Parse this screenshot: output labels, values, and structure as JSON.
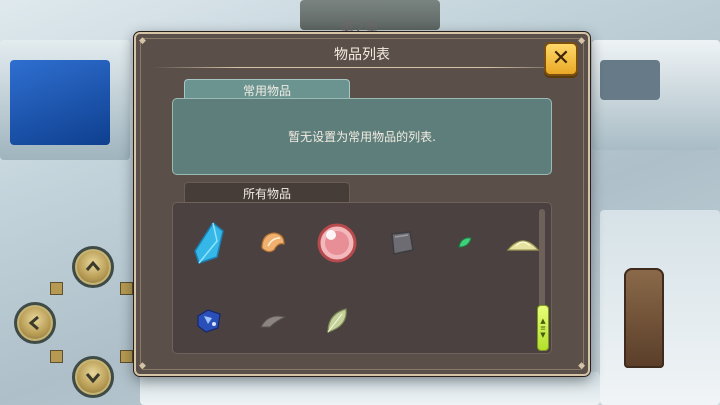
{
  "header": {
    "chapter": "第2章"
  },
  "modal": {
    "title": "物品列表",
    "close_symbol": "✕",
    "frequent_tab": "常用物品",
    "empty_message": "暂无设置为常用物品的列表.",
    "all_tab": "所有物品"
  },
  "items": [
    {
      "icon": "blue-crystal-icon"
    },
    {
      "icon": "orange-shell-icon"
    },
    {
      "icon": "pink-orb-icon"
    },
    {
      "icon": "gray-stone-icon"
    },
    {
      "icon": "green-leaf-icon"
    },
    {
      "icon": "yellow-powder-icon"
    },
    {
      "icon": "blue-ore-icon"
    },
    {
      "icon": "gray-feather-icon"
    },
    {
      "icon": "pale-green-leaf-icon"
    }
  ],
  "colors": {
    "modal_bg": "#5b4f4a",
    "frame": "#d6c4a8",
    "frequent_panel": "#5e7e7b",
    "close_button": "#f5c33e",
    "scroll_thumb": "#c8f03a"
  }
}
